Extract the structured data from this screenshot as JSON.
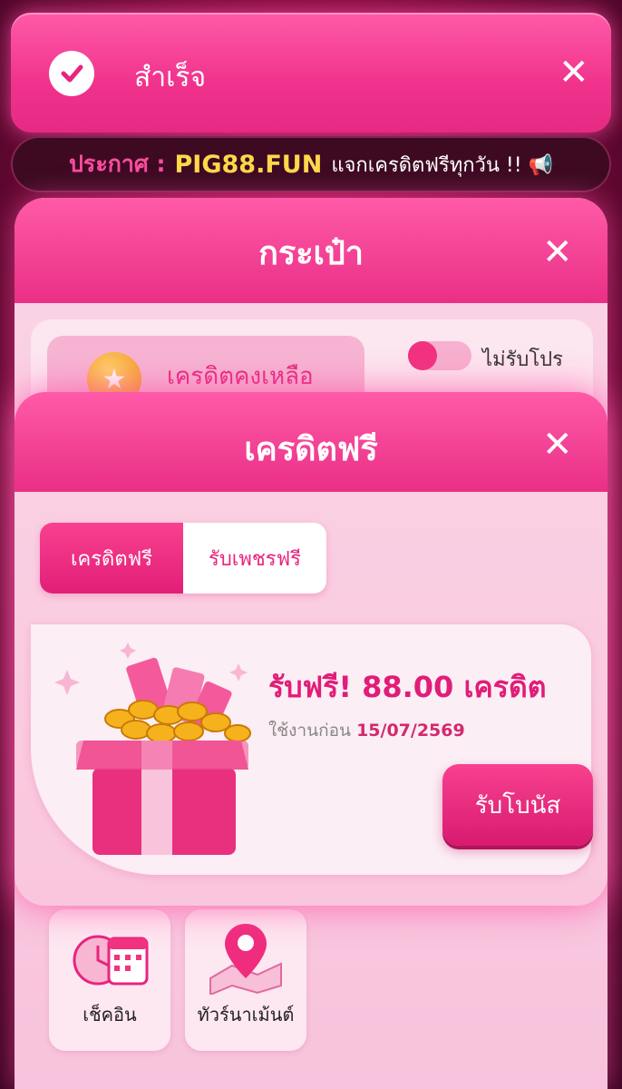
{
  "toast": {
    "title": "สำเร็จ",
    "icon": "check-circle-icon"
  },
  "announcement": {
    "label": "ประกาศ :",
    "site": "PIG88.FUN",
    "message": "แจกเครดิตฟรีทุกวัน !! 📢"
  },
  "wallet": {
    "title": "กระเป๋า",
    "credit_label": "เครดิตคงเหลือ",
    "toggle_label": "ไม่รับโปร",
    "tiles": [
      {
        "label": "เช็คอิน",
        "icon": "calendar-clock-icon"
      },
      {
        "label": "ทัวร์นาเม้นต์",
        "icon": "map-pin-icon"
      }
    ]
  },
  "free_credit": {
    "title": "เครดิตฟรี",
    "tabs": [
      {
        "label": "เครดิตฟรี",
        "active": true
      },
      {
        "label": "รับเพชรฟรี",
        "active": false
      }
    ],
    "offer": {
      "title": "รับฟรี! 88.00 เครดิต",
      "expiry_label": "ใช้งานก่อน",
      "expiry_date": "15/07/2569",
      "claim_label": "รับโบนัส"
    }
  },
  "colors": {
    "accent": "#ea2f86",
    "highlight": "#ffd84a",
    "background": "#7a0a3a"
  }
}
